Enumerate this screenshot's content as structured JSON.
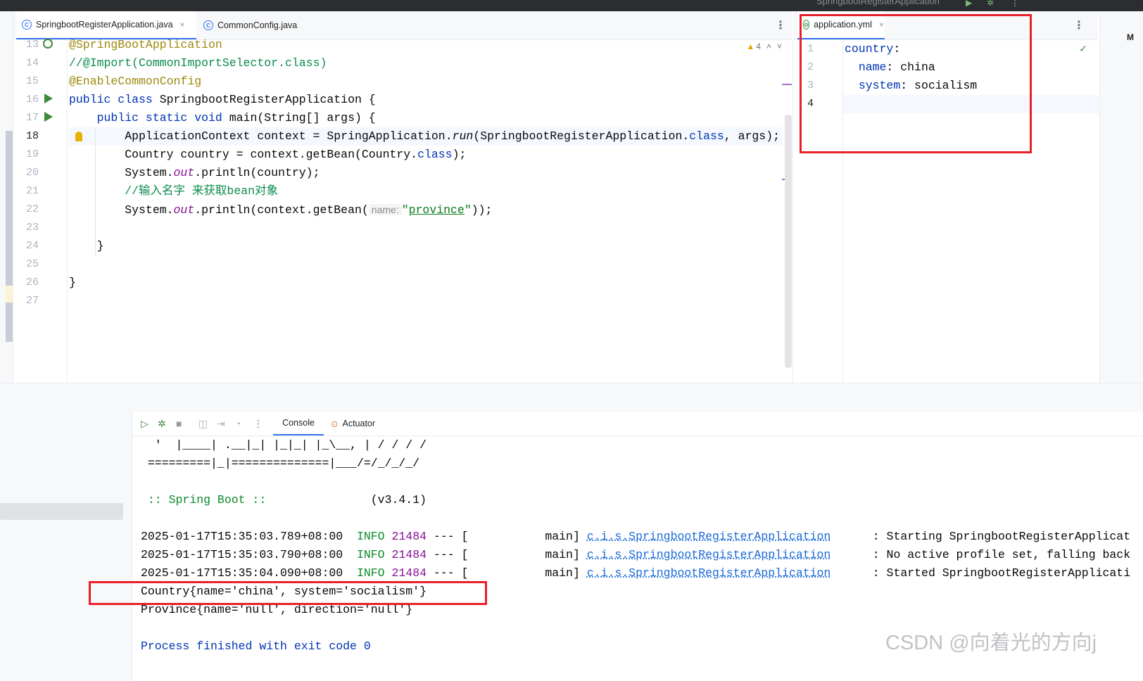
{
  "topbar": {
    "title": "SpringbootRegisterApplication"
  },
  "tabs": {
    "left": [
      {
        "label": "SpringbootRegisterApplication.java",
        "active": true
      },
      {
        "label": "CommonConfig.java",
        "active": false
      }
    ],
    "right": [
      {
        "label": "application.yml",
        "active": true
      }
    ]
  },
  "editor": {
    "warnings": "4",
    "line_numbers": [
      "13",
      "14",
      "15",
      "16",
      "17",
      "18",
      "19",
      "20",
      "21",
      "22",
      "23",
      "24",
      "25",
      "26",
      "27"
    ],
    "current_line": "18",
    "lines": {
      "l13": "@SpringBootApplication",
      "l14": "//@Import(CommonImportSelector.class)",
      "l15": "@EnableCommonConfig",
      "l16_kw": "public class",
      "l16_rest": " SpringbootRegisterApplication {",
      "l17_kw": "public static void",
      "l17_rest": " main(String[] args) {",
      "l18_a": "ApplicationContext context = SpringApplication.",
      "l18_run": "run",
      "l18_b": "(SpringbootRegisterApplication.",
      "l18_cls": "class",
      "l18_c": ", args);",
      "l19_a": "Country country = context.getBean(Country.",
      "l19_cls": "class",
      "l19_c": ");",
      "l20_a": "System.",
      "l20_out": "out",
      "l20_b": ".println(country);",
      "l21": "//输入名字 来获取bean对象",
      "l22_a": "System.",
      "l22_out": "out",
      "l22_b": ".println(context.getBean(",
      "l22_hint": "name:",
      "l22_q1": "\"",
      "l22_str": "province",
      "l22_q2": "\"",
      "l22_c": "));",
      "l24": "}",
      "l26": "}"
    }
  },
  "yaml": {
    "line_numbers": [
      "1",
      "2",
      "3",
      "4"
    ],
    "current_line": "4",
    "k1": "country",
    "k2": "name",
    "v2": "china",
    "k3": "system",
    "v3": "socialism",
    "colon": ":"
  },
  "run_panel": {
    "tabs": [
      "Console",
      "Actuator"
    ],
    "active_tab": "Console",
    "banner1": "  '  |____| .__|_| |_|_| |_\\__, | / / / /",
    "banner2": " =========|_|==============|___/=/_/_/_/",
    "spring_label": " :: Spring Boot :: ",
    "spring_version": "              (v3.4.1)",
    "logs": [
      {
        "ts": "2025-01-17T15:35:03.789+08:00",
        "level": "INFO",
        "pid": "21484",
        "sep": " --- [",
        "thread": "           main]",
        "logger": "c.i.s.SpringbootRegisterApplication",
        "msg": "      : Starting SpringbootRegisterApplicat"
      },
      {
        "ts": "2025-01-17T15:35:03.790+08:00",
        "level": "INFO",
        "pid": "21484",
        "sep": " --- [",
        "thread": "           main]",
        "logger": "c.i.s.SpringbootRegisterApplication",
        "msg": "      : No active profile set, falling back"
      },
      {
        "ts": "2025-01-17T15:35:04.090+08:00",
        "level": "INFO",
        "pid": "21484",
        "sep": " --- [",
        "thread": "           main]",
        "logger": "c.i.s.SpringbootRegisterApplication",
        "msg": "      : Started SpringbootRegisterApplicati"
      }
    ],
    "out1": "Country{name='china', system='socialism'}",
    "out2": "Province{name='null', direction='null'}",
    "finished": "Process finished with exit code 0"
  },
  "watermark": "CSDN @向着光的方向j",
  "colors": {
    "highlight_box": "#e8202a",
    "keyword": "#0033b3",
    "annotation": "#9e880d",
    "string": "#067d17"
  }
}
